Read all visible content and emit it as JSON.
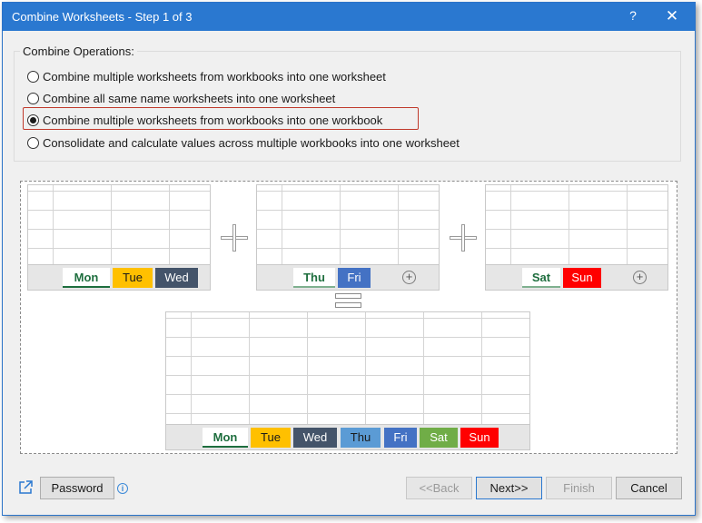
{
  "window": {
    "title": "Combine Worksheets - Step 1 of 3",
    "help_glyph": "?",
    "close_glyph": "✕"
  },
  "operations": {
    "label": "Combine Operations:",
    "options": [
      {
        "label": "Combine multiple worksheets from workbooks into one worksheet",
        "checked": false
      },
      {
        "label": "Combine all same name worksheets into one worksheet",
        "checked": false
      },
      {
        "label": "Combine multiple worksheets from workbooks into one workbook",
        "checked": true
      },
      {
        "label": "Consolidate and calculate values across multiple workbooks into one worksheet",
        "checked": false
      }
    ]
  },
  "diagram": {
    "workbook1": {
      "tabs": [
        "Mon",
        "Tue",
        "Wed"
      ]
    },
    "workbook2": {
      "tabs": [
        "Thu",
        "Fri"
      ],
      "add_glyph": "+"
    },
    "workbook3": {
      "tabs": [
        "Sat",
        "Sun"
      ],
      "add_glyph": "+"
    },
    "result": {
      "tabs": [
        "Mon",
        "Tue",
        "Wed",
        "Thu",
        "Fri",
        "Sat",
        "Sun"
      ]
    },
    "tab_colors": {
      "Mon": "#ffffff",
      "Tue": "#ffc000",
      "Wed": "#44546a",
      "Thu": "#5b9bd5",
      "Fri": "#4472c4",
      "Sat": "#70ad47",
      "Sun": "#ff0000"
    }
  },
  "footer": {
    "share_icon": "external-link-icon",
    "password_label": "Password",
    "info_glyph": "i",
    "back_label": "<<Back",
    "next_label": "Next>>",
    "finish_label": "Finish",
    "cancel_label": "Cancel"
  }
}
